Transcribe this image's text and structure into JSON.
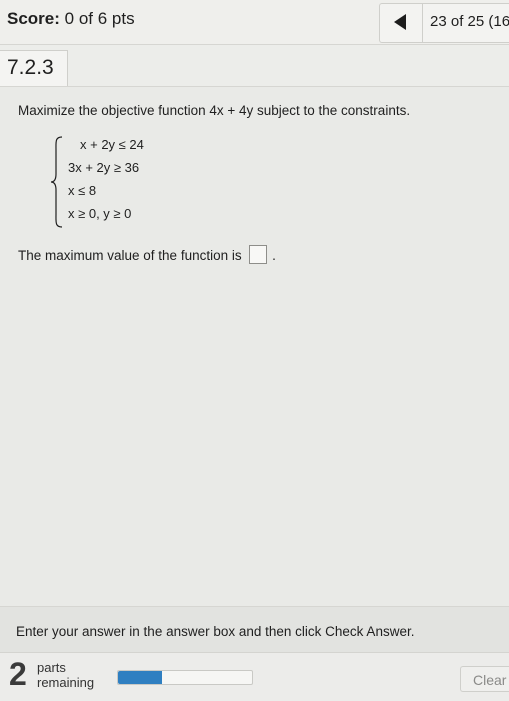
{
  "header": {
    "score_label": "Score:",
    "score_value": "0 of 6 pts",
    "position_text": "23 of 25 (16"
  },
  "question": {
    "number": "7.2.3",
    "prompt": "Maximize the objective function 4x + 4y subject to the constraints.",
    "constraints": [
      "x + 2y ≤ 24",
      "3x + 2y ≥ 36",
      "x ≤ 8",
      "x ≥ 0, y ≥ 0"
    ],
    "answer_prompt": "The maximum value of the function is",
    "answer_value": "",
    "answer_suffix": "."
  },
  "instructions": "Enter your answer in the answer box and then click Check Answer.",
  "footer": {
    "parts_count": "2",
    "parts_label_line1": "parts",
    "parts_label_line2": "remaining",
    "progress_fraction": 0.33,
    "clear_label": "Clear"
  },
  "colors": {
    "progress_fill": "#2f7fc1",
    "background": "#ecedea"
  },
  "icons": {
    "prev": "left-triangle-arrow-icon"
  }
}
